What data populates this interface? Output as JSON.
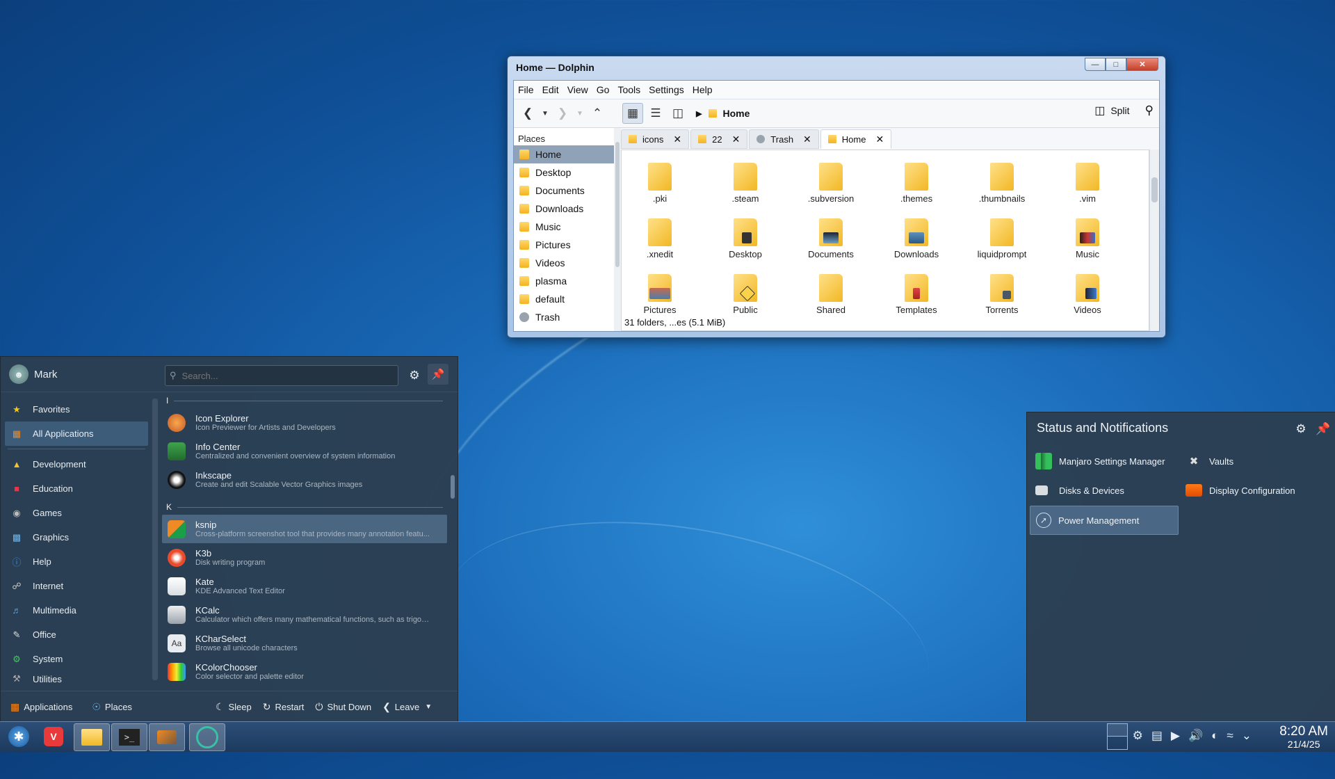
{
  "dolphin": {
    "title": "Home — Dolphin",
    "menu": [
      "File",
      "Edit",
      "View",
      "Go",
      "Tools",
      "Settings",
      "Help"
    ],
    "breadcrumb": "Home",
    "split_label": "Split",
    "places_header": "Places",
    "places": [
      "Home",
      "Desktop",
      "Documents",
      "Downloads",
      "Music",
      "Pictures",
      "Videos",
      "plasma",
      "default",
      "Trash"
    ],
    "tabs": [
      "icons",
      "22",
      "Trash",
      "Home"
    ],
    "files": [
      ".pki",
      ".steam",
      ".subversion",
      ".themes",
      ".thumbnails",
      ".vim",
      ".xnedit",
      "Desktop",
      "Documents",
      "Downloads",
      "liquidprompt",
      "Music",
      "Pictures",
      "Public",
      "Shared",
      "Templates",
      "Torrents",
      "Videos"
    ],
    "status": "31 folders, ...es (5.1 MiB)"
  },
  "launcher": {
    "user": "Mark",
    "search_placeholder": "Search...",
    "categories": [
      "Favorites",
      "All Applications",
      "Development",
      "Education",
      "Games",
      "Graphics",
      "Help",
      "Internet",
      "Multimedia",
      "Office",
      "System",
      "Utilities"
    ],
    "sections": {
      "i": "I",
      "k": "K"
    },
    "apps_i": [
      {
        "name": "Icon Explorer",
        "desc": "Icon Previewer for Artists and Developers"
      },
      {
        "name": "Info Center",
        "desc": "Centralized and convenient overview of system information"
      },
      {
        "name": "Inkscape",
        "desc": "Create and edit Scalable Vector Graphics images"
      }
    ],
    "apps_k": [
      {
        "name": "ksnip",
        "desc": "Cross-platform screenshot tool that provides many annotation featu..."
      },
      {
        "name": "K3b",
        "desc": "Disk writing program"
      },
      {
        "name": "Kate",
        "desc": "KDE Advanced Text Editor"
      },
      {
        "name": "KCalc",
        "desc": "Calculator which offers many mathematical functions, such as trigon..."
      },
      {
        "name": "KCharSelect",
        "desc": "Browse all unicode characters"
      },
      {
        "name": "KColorChooser",
        "desc": "Color selector and palette editor"
      }
    ],
    "footer": {
      "applications": "Applications",
      "places": "Places",
      "sleep": "Sleep",
      "restart": "Restart",
      "shutdown": "Shut Down",
      "leave": "Leave"
    }
  },
  "status_panel": {
    "title": "Status and Notifications",
    "items": [
      "Manjaro Settings Manager",
      "Vaults",
      "Disks & Devices",
      "Display Configuration",
      "Power Management"
    ]
  },
  "taskbar": {
    "time": "8:20 AM",
    "date": "21/4/25"
  }
}
